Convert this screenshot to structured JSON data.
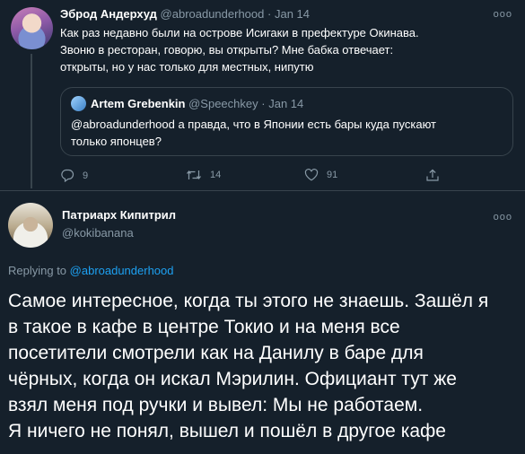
{
  "tweet1": {
    "author_name": "Эброд Андерхуд",
    "author_handle": "@abroadunderhood",
    "separator": "·",
    "date": "Jan 14",
    "more_label": "ooo",
    "text_lines": [
      "Как раз недавно были на острове Исигаки в префектуре Окинава.",
      "Звоню в ресторан, говорю, вы открыты? Мне бабка отвечает:",
      "открыты, но у нас только для местных, нипутю"
    ],
    "quote": {
      "author_name": "Artem Grebenkin",
      "author_handle": "@Speechkey",
      "separator": "·",
      "date": "Jan 14",
      "text_lines": [
        "@abroadunderhood а правда, что в Японии есть бары куда пускают",
        "только японцев?"
      ]
    },
    "actions": {
      "reply_count": "9",
      "retweet_count": "14",
      "like_count": "91"
    }
  },
  "tweet2": {
    "author_name": "Патриарх Кипитрил",
    "author_handle": "@kokibanana",
    "more_label": "ooo",
    "replying_prefix": "Replying to ",
    "replying_handle": "@abroadunderhood",
    "text_lines": [
      "Самое интересное, когда ты этого не знаешь. Зашёл я",
      "в такое в кафе в центре Токио и на меня все",
      "посетители смотрели как на Данилу в баре для",
      "чёрных, когда он искал Мэрилин. Официант тут же",
      "взял меня под ручки и вывел: Мы не работаем.",
      "Я ничего не понял, вышел и пошёл в другое кафе"
    ]
  },
  "colors": {
    "background": "#15202b",
    "text": "#ffffff",
    "muted": "#8899a6",
    "link": "#1da1f2",
    "border": "#38444d"
  }
}
